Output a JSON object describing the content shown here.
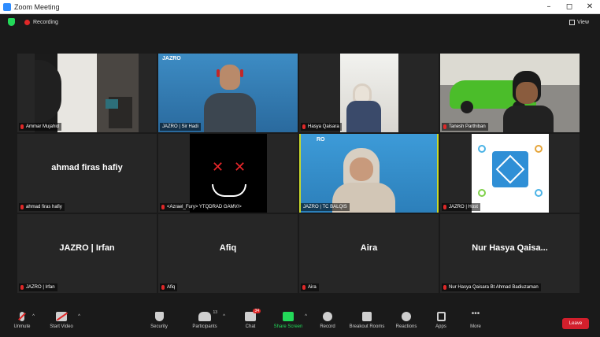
{
  "window": {
    "title": "Zoom Meeting",
    "controls": [
      "–",
      "◻",
      "✕"
    ]
  },
  "status": {
    "recording_label": "Recording",
    "view_label": "View"
  },
  "participants": [
    {
      "name": "Ammar Mujahid",
      "display": "",
      "video": true,
      "muted": true
    },
    {
      "name": "JAZRO | Sir Hadi",
      "display": "",
      "video": true,
      "muted": false,
      "banner": "JAZRO"
    },
    {
      "name": "Hasya Qaisara",
      "display": "",
      "video": true,
      "muted": true
    },
    {
      "name": "Tanesh Parthiban",
      "display": "",
      "video": true,
      "muted": true
    },
    {
      "name": "ahmad firas hafiy",
      "display": "ahmad firas hafiy",
      "video": false,
      "muted": true
    },
    {
      "name": "<Azrael_Fury> YTQDRAD GAMV/>",
      "display": "",
      "video": true,
      "muted": true
    },
    {
      "name": "JAZRO | TC BALQIS",
      "display": "",
      "video": true,
      "muted": false,
      "active": true,
      "banner": "RO"
    },
    {
      "name": "JAZRO | Host",
      "display": "",
      "video": true,
      "muted": true
    },
    {
      "name": "JAZRO | Irfan",
      "display": "JAZRO | Irfan",
      "video": false,
      "muted": true
    },
    {
      "name": "Afiq",
      "display": "Afiq",
      "video": false,
      "muted": true
    },
    {
      "name": "Aira",
      "display": "Aira",
      "video": false,
      "muted": true
    },
    {
      "name": "Nur Hasya Qaisara Bt Ahmad Badiuzaman",
      "display": "Nur Hasya Qaisa...",
      "video": false,
      "muted": true
    }
  ],
  "toolbar": {
    "unmute": "Unmute",
    "start_video": "Start Video",
    "security": "Security",
    "participants": "Participants",
    "participants_count": "13",
    "chat": "Chat",
    "chat_badge": "34",
    "share_screen": "Share Screen",
    "record": "Record",
    "breakout_rooms": "Breakout Rooms",
    "reactions": "Reactions",
    "apps": "Apps",
    "more": "More",
    "leave": "Leave"
  },
  "colors": {
    "accent_green": "#23d959",
    "recording_red": "#e02828",
    "active_speaker": "#c9d92b",
    "leave_red": "#d21f2c",
    "jazro_blue": "#2f7fb5"
  }
}
